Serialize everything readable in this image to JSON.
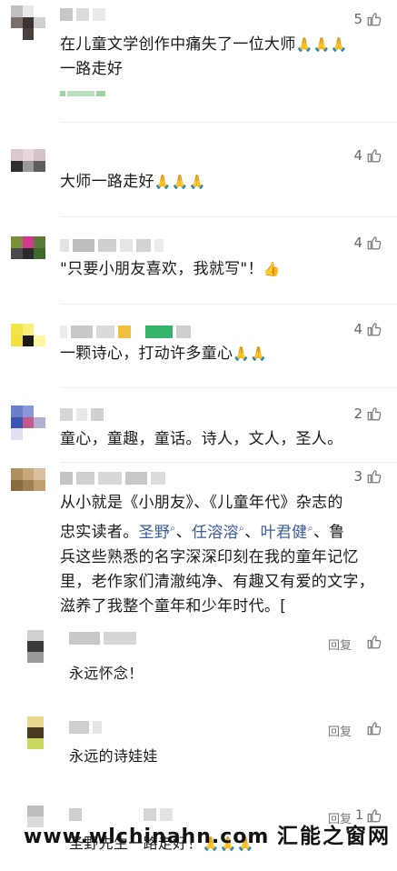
{
  "comments": [
    {
      "likes": "5",
      "text_line1": "在儿童文学创作中痛失了一位大师",
      "hands": "🙏🙏🙏",
      "text_line2": "一路走好"
    },
    {
      "likes": "4",
      "text": "大师一路走好",
      "hands": "🙏🙏🙏"
    },
    {
      "likes": "4",
      "text": "\"只要小朋友喜欢，我就写\"！",
      "thumb": "👍"
    },
    {
      "likes": "4",
      "text": "一颗诗心，打动许多童心",
      "hands": "🙏🙏"
    },
    {
      "likes": "2",
      "text": "童心，童趣，童话。诗人，文人，圣人。"
    },
    {
      "likes": "3",
      "line1": "从小就是《小朋友》、《儿童年代》杂志的",
      "line2_prefix": "忠实读者。",
      "mentions": [
        "圣野",
        "任溶溶",
        "叶君健"
      ],
      "line2_suffix": "、鲁",
      "line3": "兵这些熟悉的名字深深印刻在我的童年记忆",
      "line4": "里，老作家们清澈纯净、有趣又有爱的文字，",
      "line5": "滋养了我整个童年和少年时代。["
    }
  ],
  "replies": [
    {
      "reply_label": "回复",
      "text": "永远怀念！"
    },
    {
      "reply_label": "回复",
      "text": "永远的诗娃娃"
    },
    {
      "reply_label": "回复",
      "likes": "1",
      "text": "圣野先生一路走好！",
      "hands": "🙏🙏🙏"
    }
  ],
  "watermark": {
    "url": "www.wlchinahn.com",
    "cn": "汇能之窗网"
  },
  "colors": {
    "mention": "#3b5b9a",
    "meta": "#666666"
  },
  "icons": {
    "like": "thumbs-up-outline-icon",
    "search": "search-icon"
  }
}
